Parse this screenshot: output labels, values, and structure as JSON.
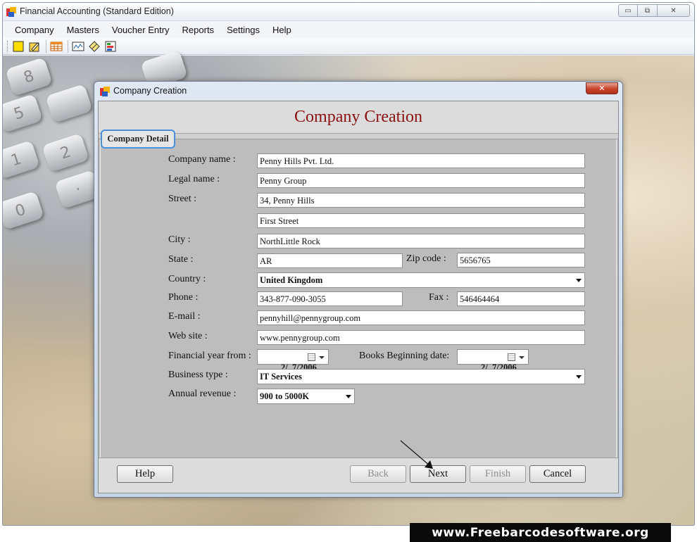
{
  "window": {
    "title": "Financial Accounting (Standard Edition)",
    "controls": {
      "minimize": "▭",
      "maximize": "⧉",
      "close": "✕"
    }
  },
  "menu": [
    "Company",
    "Masters",
    "Voucher Entry",
    "Reports",
    "Settings",
    "Help"
  ],
  "toolbar_icons": [
    "new-icon",
    "open-icon",
    "grid-icon",
    "report-icon",
    "edit-icon",
    "chart-icon"
  ],
  "dialog": {
    "title": "Company Creation",
    "heading": "Company Creation",
    "close": "✕",
    "tab": "Company Detail",
    "labels": {
      "company_name": "Company name :",
      "legal_name": "Legal name :",
      "street": "Street :",
      "city": "City :",
      "state": "State :",
      "zip": "Zip code :",
      "country": "Country :",
      "phone": "Phone :",
      "fax": "Fax :",
      "email": "E-mail :",
      "website": "Web site :",
      "fy_from": "Financial year from :",
      "books_begin": "Books Beginning date:",
      "business_type": "Business type :",
      "annual_revenue": "Annual revenue :"
    },
    "values": {
      "company_name": "Penny Hills Pvt. Ltd.",
      "legal_name": "Penny Group",
      "street1": "34, Penny Hills",
      "street2": "First Street",
      "city": "NorthLittle Rock",
      "state": "AR",
      "zip": "5656765",
      "country": "United Kingdom",
      "phone": "343-877-090-3055",
      "fax": "546464464",
      "email": "pennyhill@pennygroup.com",
      "website": "www.pennygroup.com",
      "fy_from": "2/  7/2006",
      "books_begin": "2/  7/2006",
      "business_type": "IT Services",
      "annual_revenue": "900 to 5000K"
    },
    "buttons": {
      "help": "Help",
      "back": "Back",
      "next": "Next",
      "finish": "Finish",
      "cancel": "Cancel"
    }
  },
  "watermark": "www.Freebarcodesoftware.org",
  "colors": {
    "heading": "#8b1010",
    "tab_border": "#4a90d9",
    "close_red": "#c8432b"
  }
}
